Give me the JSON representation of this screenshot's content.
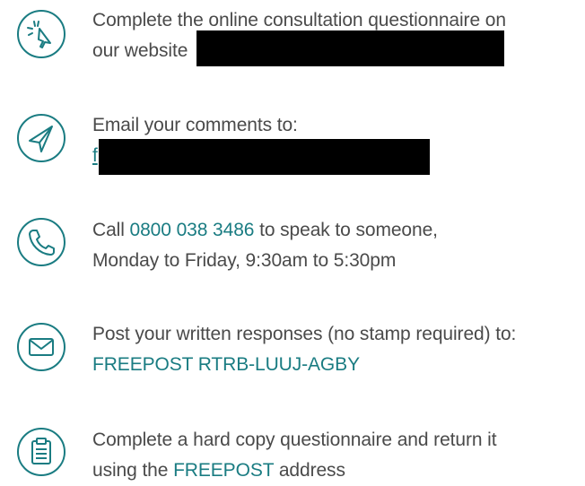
{
  "methods": [
    {
      "icon": "cursor-click-icon",
      "line1": "Complete the online consultation questionnaire on",
      "line2_prefix": "our website"
    },
    {
      "icon": "paper-plane-icon",
      "line1": "Email your comments to:",
      "link_fragment": "f"
    },
    {
      "icon": "phone-icon",
      "line1_prefix": "Call ",
      "phone": "0800 038 3486",
      "line1_suffix": " to speak to someone,",
      "line2": "Monday to Friday, 9:30am to 5:30pm"
    },
    {
      "icon": "envelope-icon",
      "line1": "Post your written responses (no stamp required) to:",
      "address": "FREEPOST RTRB-LUUJ-AGBY"
    },
    {
      "icon": "clipboard-icon",
      "line1": "Complete a hard copy questionnaire and return it",
      "line2_prefix": "using the ",
      "freepost": "FREEPOST",
      "line2_suffix": " address"
    }
  ],
  "colors": {
    "accent": "#1a7c82",
    "text": "#4a4a4a",
    "redaction": "#000000"
  }
}
